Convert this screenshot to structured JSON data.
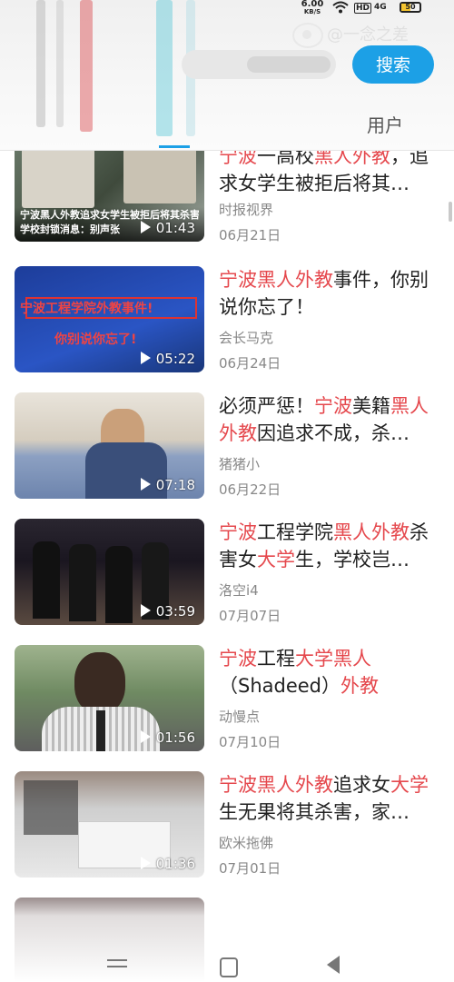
{
  "status_bar": {
    "speed": "6.00",
    "speed_unit": "KB/S",
    "signal": "4G",
    "hd": "HD",
    "battery": "50",
    "battery_level": 0.5
  },
  "watermark": "@一念之差",
  "search": {
    "button_label": "搜索"
  },
  "tabs": {
    "users": "用户"
  },
  "videos": [
    {
      "title": [
        {
          "t": "宁波",
          "hl": true
        },
        {
          "t": "一高校",
          "hl": false
        },
        {
          "t": "黑人外教",
          "hl": true
        },
        {
          "t": "，追求女学生被拒后将其…",
          "hl": false
        }
      ],
      "author": "时报视界",
      "date": "06月21日",
      "duration": "01:43",
      "caption_1": "宁波黑人外教追求女学生被拒后将其杀害",
      "caption_2": "学校封锁消息：别声张"
    },
    {
      "title": [
        {
          "t": "宁波黑人外教",
          "hl": true
        },
        {
          "t": "事件，你别说你忘了！",
          "hl": false
        }
      ],
      "author": "会长马克",
      "date": "06月24日",
      "duration": "05:22",
      "caption_1": "宁波工程学院外教事件!",
      "caption_2": "你别说你忘了!"
    },
    {
      "title": [
        {
          "t": "必须严惩！",
          "hl": false
        },
        {
          "t": "宁波",
          "hl": true
        },
        {
          "t": "美籍",
          "hl": false
        },
        {
          "t": "黑人外教",
          "hl": true
        },
        {
          "t": "因追求不成，杀…",
          "hl": false
        }
      ],
      "author": "猪猪小",
      "date": "06月22日",
      "duration": "07:18"
    },
    {
      "title": [
        {
          "t": "宁波",
          "hl": true
        },
        {
          "t": "工程学院",
          "hl": false
        },
        {
          "t": "黑人外教",
          "hl": true
        },
        {
          "t": "杀害女",
          "hl": false
        },
        {
          "t": "大学",
          "hl": true
        },
        {
          "t": "生，学校岂…",
          "hl": false
        }
      ],
      "author": "洛空i4",
      "date": "07月07日",
      "duration": "03:59"
    },
    {
      "title": [
        {
          "t": "宁波",
          "hl": true
        },
        {
          "t": "工程",
          "hl": false
        },
        {
          "t": "大学黑人",
          "hl": true
        },
        {
          "t": "（Shadeed）",
          "hl": false
        },
        {
          "t": "外教",
          "hl": true
        }
      ],
      "author": "动慢点",
      "date": "07月10日",
      "duration": "01:56"
    },
    {
      "title": [
        {
          "t": "宁波黑人外教",
          "hl": true
        },
        {
          "t": "追求女",
          "hl": false
        },
        {
          "t": "大学",
          "hl": true
        },
        {
          "t": "生无果将其杀害，家…",
          "hl": false
        }
      ],
      "author": "欧米拖佛",
      "date": "07月01日",
      "duration": "01:36"
    }
  ],
  "colors": {
    "accent": "#1ca0e6",
    "highlight": "#e5484d"
  }
}
